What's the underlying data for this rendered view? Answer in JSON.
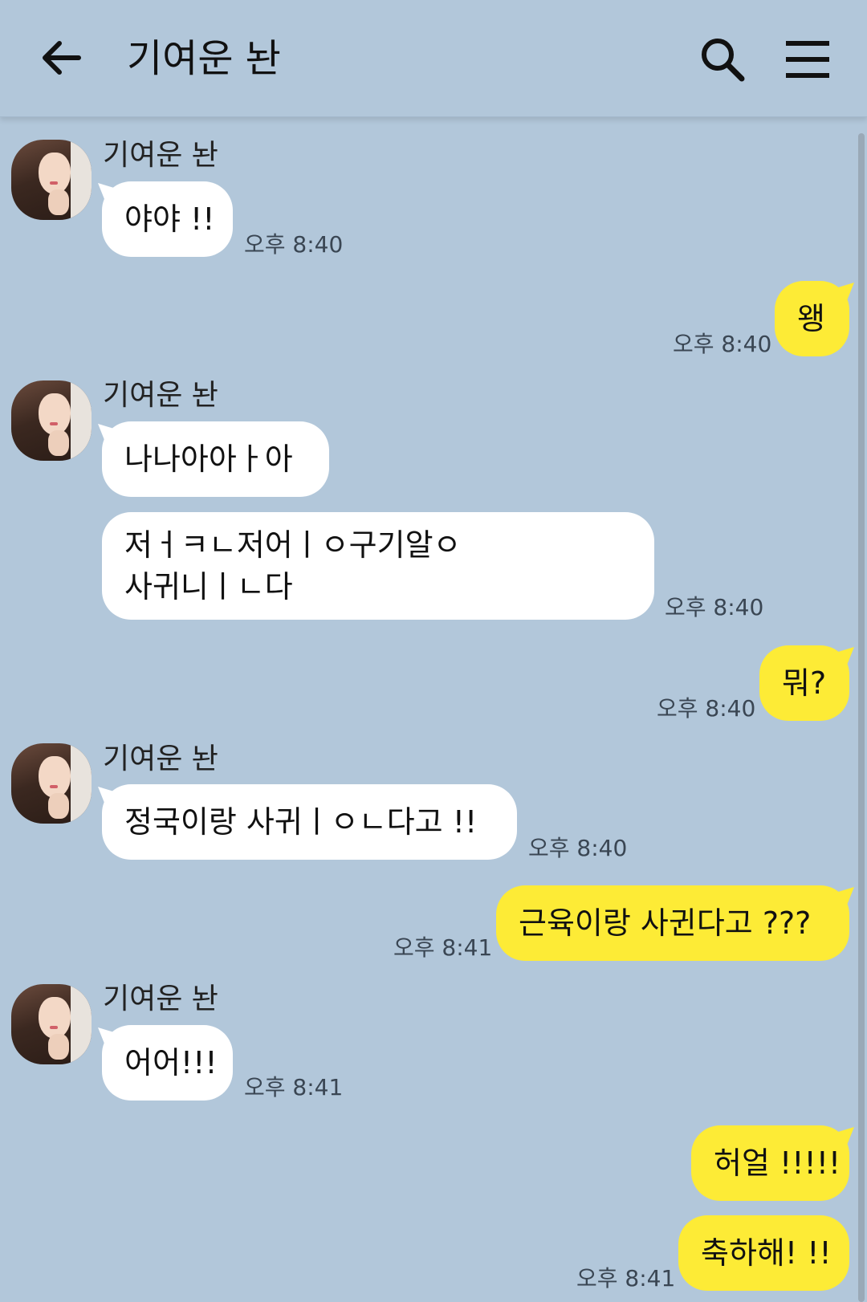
{
  "header": {
    "title": "기여운 놘"
  },
  "messages": {
    "m1": {
      "sender": "기여운 놘",
      "text": "야야 !!",
      "time": "오후 8:40"
    },
    "m2": {
      "text": "왱",
      "time": "오후 8:40"
    },
    "m3": {
      "sender": "기여운 놘",
      "text": "나나아아ㅏ아"
    },
    "m4": {
      "text": "저ㅓㅋㄴ저어ㅣㅇ구기알ㅇ\n사귀니ㅣㄴ다",
      "time": "오후 8:40"
    },
    "m5": {
      "text": "뭐?",
      "time": "오후 8:40"
    },
    "m6": {
      "sender": "기여운 놘",
      "text": "정국이랑 사귀ㅣㅇㄴ다고 !!",
      "time": "오후 8:40"
    },
    "m7": {
      "text": "근육이랑 사귄다고 ???",
      "time": "오후 8:41"
    },
    "m8": {
      "sender": "기여운 놘",
      "text": "어어!!!",
      "time": "오후 8:41"
    },
    "m9": {
      "text": "허얼 !!!!!"
    },
    "m10": {
      "text": "축하해! !!",
      "time": "오후 8:41"
    }
  },
  "colors": {
    "background": "#b2c7da",
    "incoming_bubble": "#ffffff",
    "outgoing_bubble": "#fdeb36"
  },
  "icons": {
    "back": "arrow-left-icon",
    "search": "search-icon",
    "menu": "hamburger-menu-icon",
    "avatar": "profile-photo"
  }
}
